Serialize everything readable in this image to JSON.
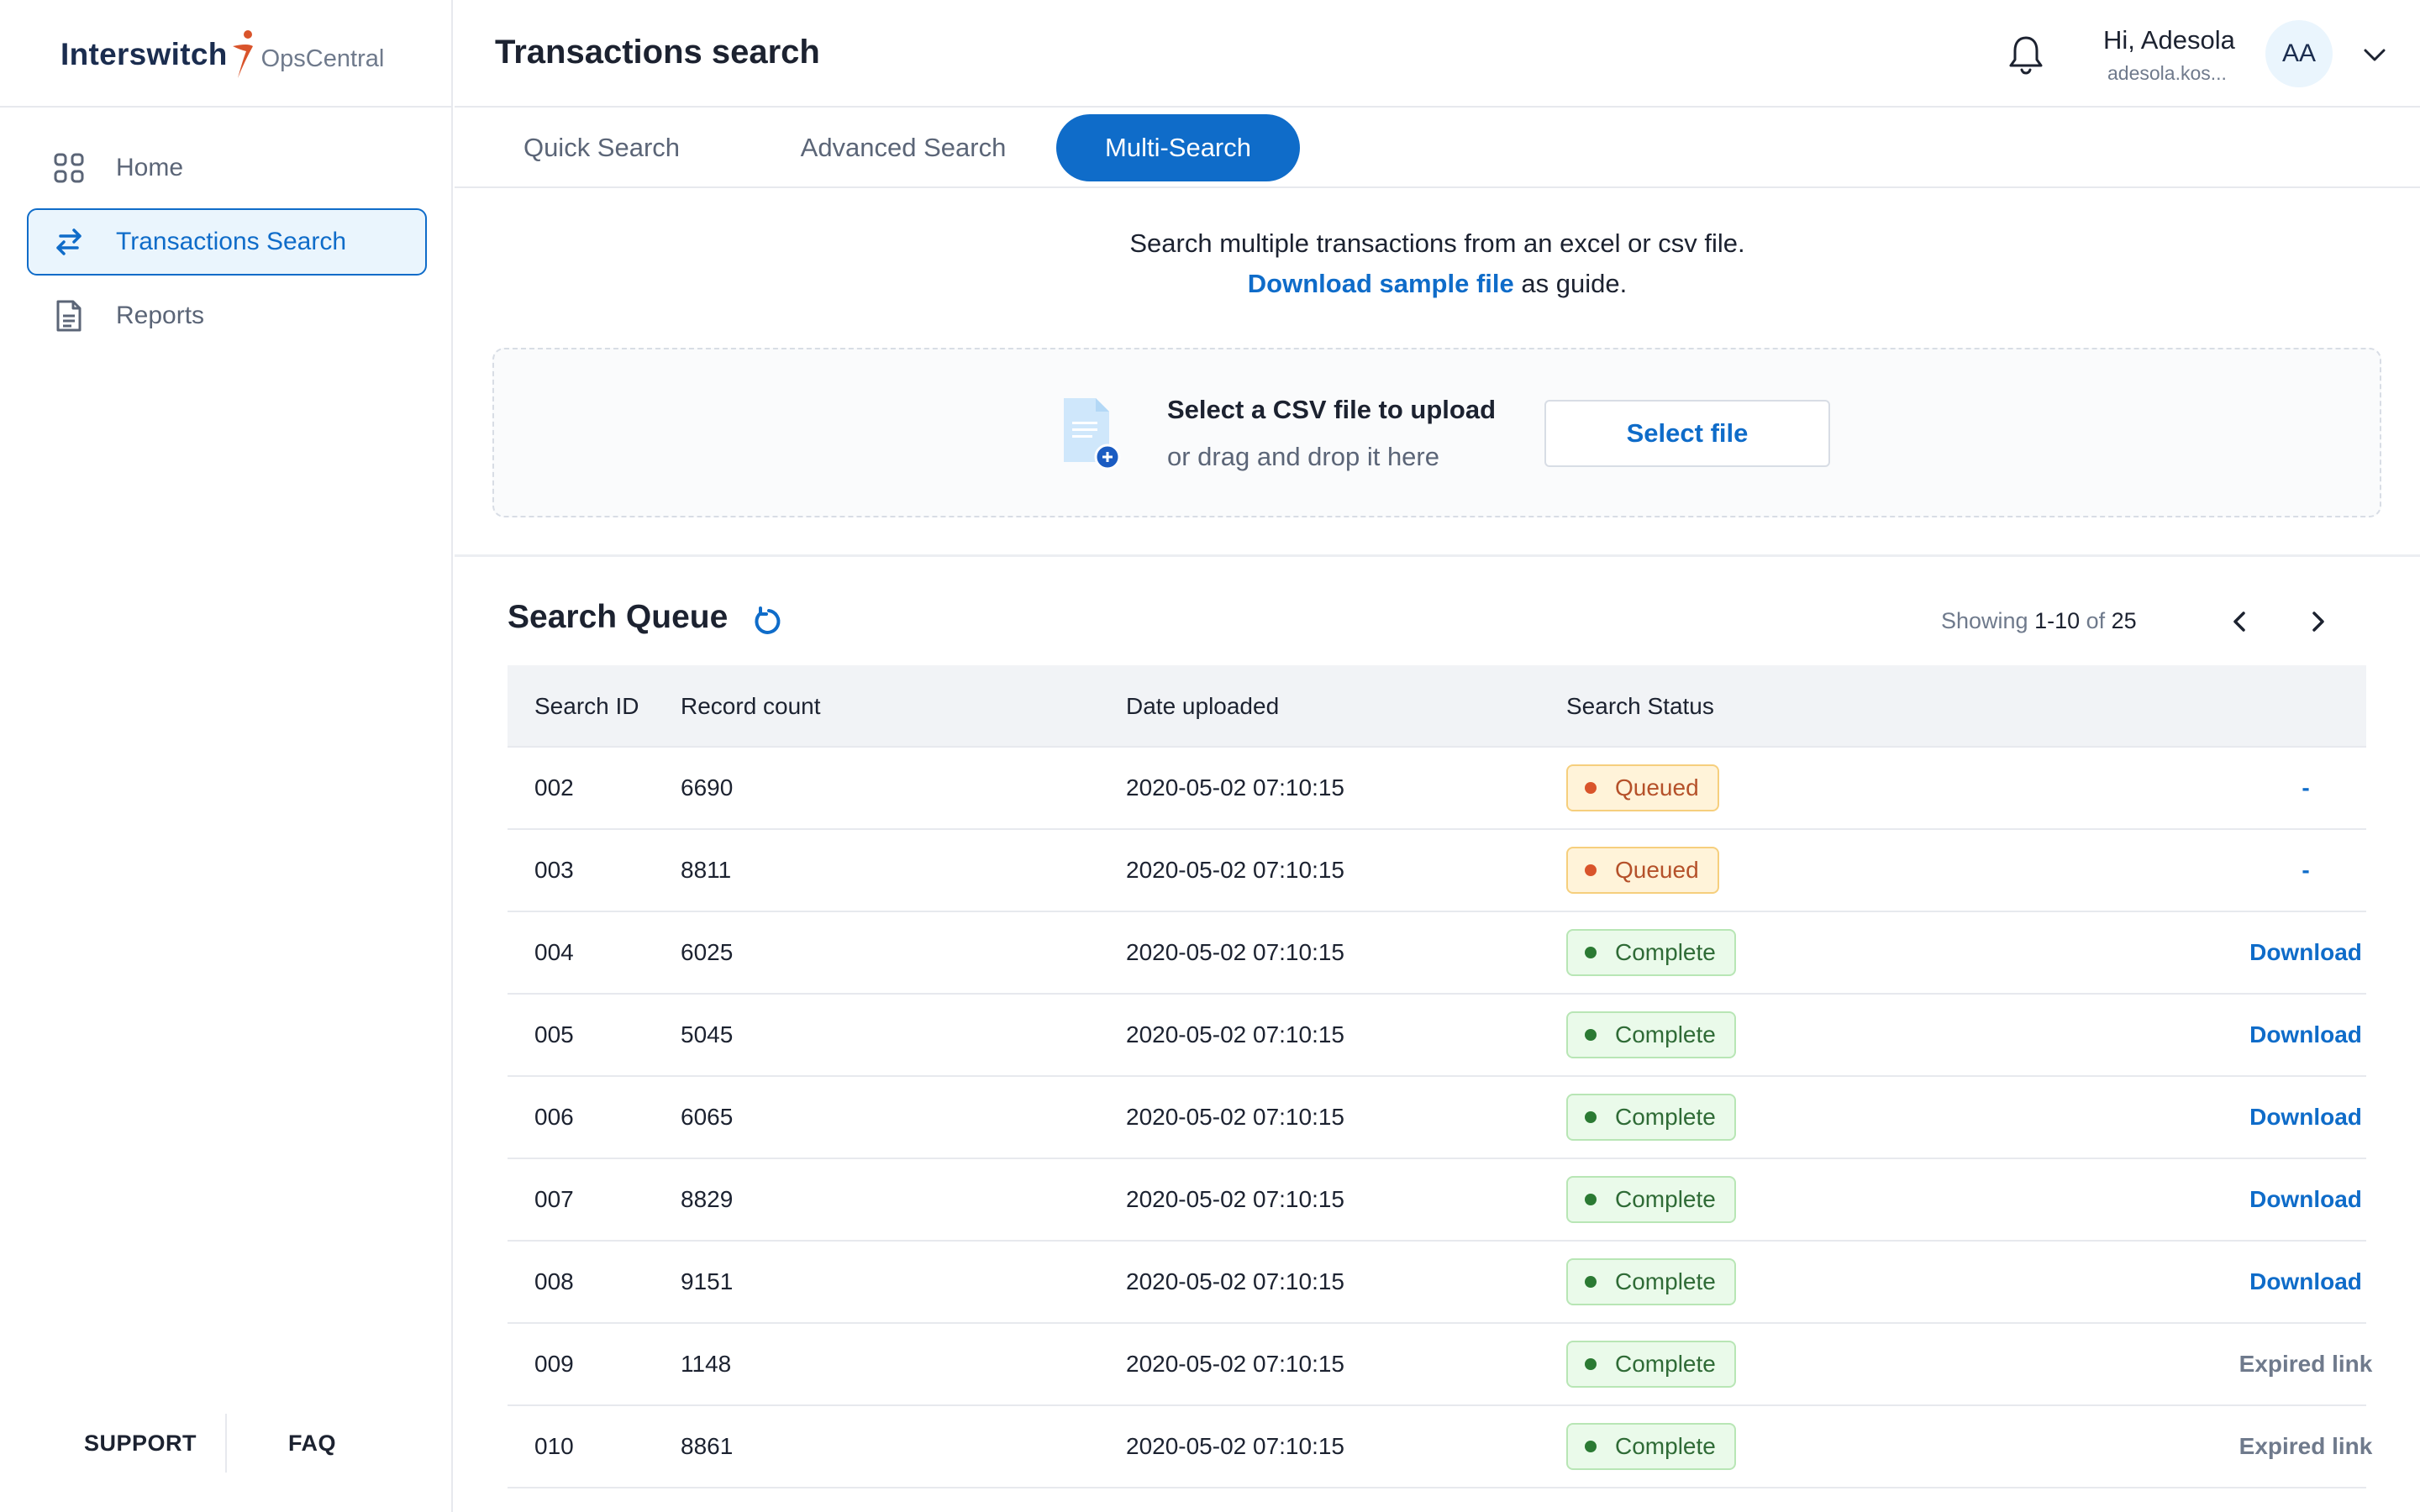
{
  "app": {
    "logo_main": "Interswitch",
    "logo_sub": "OpsCentral",
    "brand_color": "#0f6cc9",
    "logo_accent": "#d9542b"
  },
  "sidebar": {
    "items": [
      {
        "label": "Home",
        "icon": "grid-icon",
        "active": false
      },
      {
        "label": "Transactions Search",
        "icon": "swap-arrows-icon",
        "active": true
      },
      {
        "label": "Reports",
        "icon": "document-icon",
        "active": false
      }
    ],
    "footer": {
      "support": "SUPPORT",
      "faq": "FAQ"
    }
  },
  "header": {
    "title": "Transactions search",
    "greeting": "Hi, Adesola",
    "email": "adesola.kos...",
    "avatar_initials": "AA"
  },
  "tabs": [
    {
      "label": "Quick Search",
      "active": false
    },
    {
      "label": "Advanced Search",
      "active": false
    },
    {
      "label": "Multi-Search",
      "active": true
    }
  ],
  "upload": {
    "intro": "Search multiple transactions from an excel or csv file.",
    "sample_link": "Download sample file",
    "sample_suffix": " as guide.",
    "drop_title": "Select a CSV file to upload",
    "drop_sub": "or drag and drop it here",
    "select_button": "Select file"
  },
  "queue": {
    "title": "Search Queue",
    "showing_prefix": "Showing ",
    "showing_range": "1-10",
    "showing_of": " of ",
    "showing_total": "25",
    "columns": [
      "Search ID",
      "Record count",
      "Date uploaded",
      "Search Status"
    ],
    "rows": [
      {
        "id": "002",
        "count": "6690",
        "date": "2020-05-02 07:10:15",
        "status": "Queued",
        "action": "-"
      },
      {
        "id": "003",
        "count": "8811",
        "date": "2020-05-02 07:10:15",
        "status": "Queued",
        "action": "-"
      },
      {
        "id": "004",
        "count": "6025",
        "date": "2020-05-02 07:10:15",
        "status": "Complete",
        "action": "Download"
      },
      {
        "id": "005",
        "count": "5045",
        "date": "2020-05-02 07:10:15",
        "status": "Complete",
        "action": "Download"
      },
      {
        "id": "006",
        "count": "6065",
        "date": "2020-05-02 07:10:15",
        "status": "Complete",
        "action": "Download"
      },
      {
        "id": "007",
        "count": "8829",
        "date": "2020-05-02 07:10:15",
        "status": "Complete",
        "action": "Download"
      },
      {
        "id": "008",
        "count": "9151",
        "date": "2020-05-02 07:10:15",
        "status": "Complete",
        "action": "Download"
      },
      {
        "id": "009",
        "count": "1148",
        "date": "2020-05-02 07:10:15",
        "status": "Complete",
        "action": "Expired link"
      },
      {
        "id": "010",
        "count": "8861",
        "date": "2020-05-02 07:10:15",
        "status": "Complete",
        "action": "Expired link"
      }
    ]
  }
}
